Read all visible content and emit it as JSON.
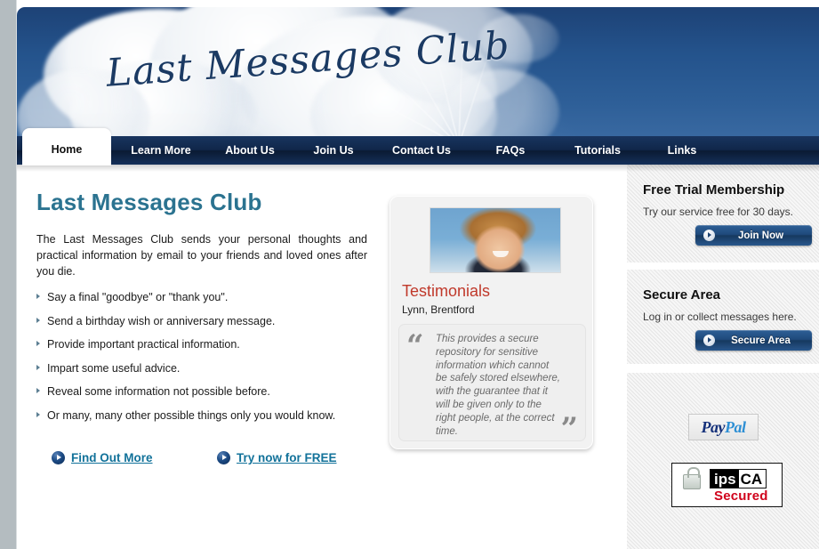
{
  "site": {
    "logo": "Last Messages Club",
    "logo_part_a": "Last Me",
    "logo_part_b": "ssages Club"
  },
  "nav": {
    "items": [
      {
        "label": "Home",
        "active": true
      },
      {
        "label": "Learn More",
        "active": false
      },
      {
        "label": "About Us",
        "active": false
      },
      {
        "label": "Join Us",
        "active": false
      },
      {
        "label": "Contact Us",
        "active": false
      },
      {
        "label": "FAQs",
        "active": false
      },
      {
        "label": "Tutorials",
        "active": false
      },
      {
        "label": "Links",
        "active": false
      }
    ]
  },
  "main": {
    "title": "Last Messages Club",
    "intro": "The Last Messages Club sends your personal thoughts and practical information by email to your friends and loved ones after you die.",
    "bullets": [
      "Say a final \"goodbye\" or \"thank you\".",
      "Send a birthday wish or anniversary message.",
      "Provide important practical information.",
      "Impart some useful advice.",
      "Reveal some information not possible before.",
      "Or many, many other possible things only you would know."
    ],
    "cta_primary": "Find Out More",
    "cta_secondary": "Try now for FREE"
  },
  "testimonial": {
    "heading": "Testimonials",
    "author": "Lynn, Brentford",
    "quote_open": "“",
    "quote_close": "”",
    "quote": "This provides a secure repository for sensitive information which cannot be safely stored elsewhere, with the guarantee that it will be given only to the right people, at the correct time."
  },
  "sidebar": {
    "free_trial": {
      "title": "Free Trial Membership",
      "description": "Try our service free for 30 days.",
      "button_label": "Join Now"
    },
    "secure_area": {
      "title": "Secure Area",
      "description": "Log in or collect messages here.",
      "button_label": "Secure Area"
    },
    "badges": {
      "paypal_a": "Pay",
      "paypal_b": "Pal",
      "ipsca_a": "ips",
      "ipsca_b": "CA",
      "ipsca_secured": "Secured"
    }
  },
  "colors": {
    "nav_bg": "#10264a",
    "title_teal": "#2b7390",
    "link_teal": "#12729a",
    "testimonial_red": "#c0392b",
    "button_blue": "#1f4a7c",
    "secured_red": "#d0021b"
  }
}
